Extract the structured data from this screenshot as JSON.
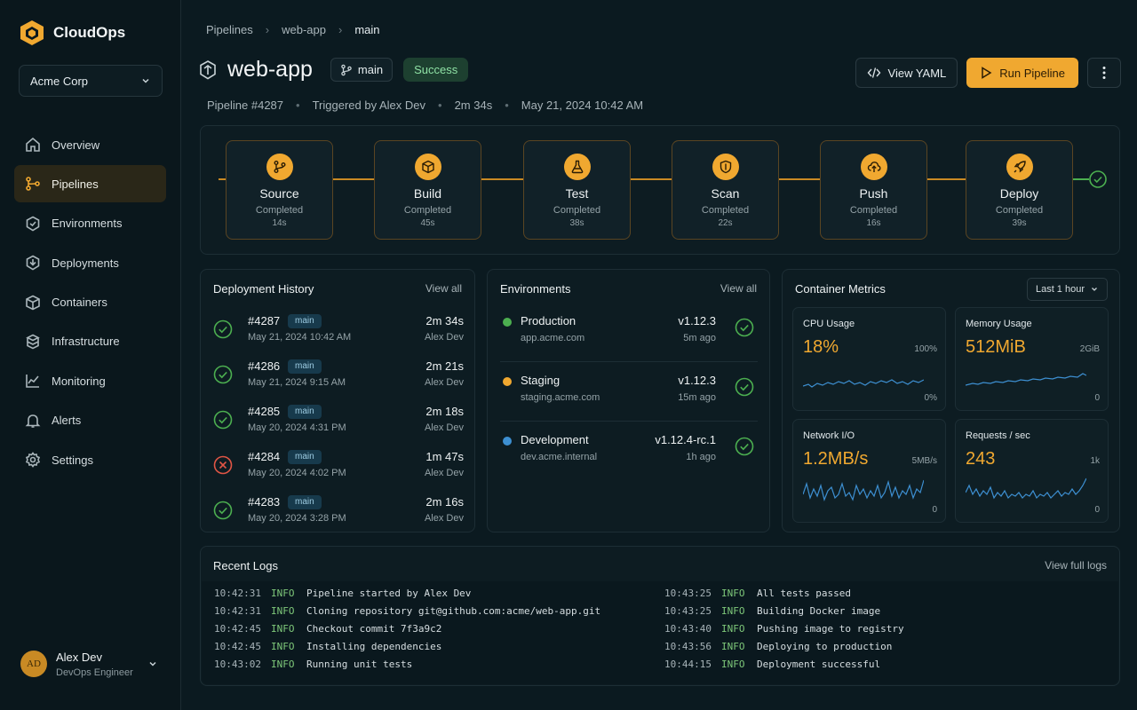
{
  "app": {
    "name": "CloudOps"
  },
  "org": {
    "name": "Acme Corp"
  },
  "sidebar": {
    "items": [
      {
        "label": "Overview",
        "icon": "home-icon"
      },
      {
        "label": "Pipelines",
        "icon": "pipeline-icon",
        "active": true
      },
      {
        "label": "Environments",
        "icon": "environment-icon"
      },
      {
        "label": "Deployments",
        "icon": "deployment-icon"
      },
      {
        "label": "Containers",
        "icon": "container-icon"
      },
      {
        "label": "Infrastructure",
        "icon": "infrastructure-icon"
      },
      {
        "label": "Monitoring",
        "icon": "monitoring-icon"
      },
      {
        "label": "Alerts",
        "icon": "bell-icon"
      },
      {
        "label": "Settings",
        "icon": "gear-icon"
      }
    ]
  },
  "user": {
    "initials": "AD",
    "name": "Alex Dev",
    "role": "DevOps Engineer"
  },
  "breadcrumb": [
    "Pipelines",
    "web-app",
    "main"
  ],
  "header": {
    "title": "web-app",
    "branch": "main",
    "status": "Success",
    "meta": [
      "Pipeline #4287",
      "Triggered by Alex Dev",
      "2m 34s",
      "May 21, 2024 10:42 AM"
    ],
    "view_yaml": "View YAML",
    "run_pipeline": "Run Pipeline"
  },
  "stages": [
    {
      "name": "Source",
      "status": "Completed",
      "time": "14s",
      "icon": "git-branch-icon"
    },
    {
      "name": "Build",
      "status": "Completed",
      "time": "45s",
      "icon": "box-icon"
    },
    {
      "name": "Test",
      "status": "Completed",
      "time": "38s",
      "icon": "flask-icon"
    },
    {
      "name": "Scan",
      "status": "Completed",
      "time": "22s",
      "icon": "shield-icon"
    },
    {
      "name": "Push",
      "status": "Completed",
      "time": "16s",
      "icon": "cloud-upload-icon"
    },
    {
      "name": "Deploy",
      "status": "Completed",
      "time": "39s",
      "icon": "rocket-icon"
    }
  ],
  "history": {
    "title": "Deployment History",
    "view_all": "View all",
    "rows": [
      {
        "id": "#4287",
        "branch": "main",
        "date": "May 21, 2024 10:42 AM",
        "duration": "2m 34s",
        "by": "Alex Dev",
        "ok": true
      },
      {
        "id": "#4286",
        "branch": "main",
        "date": "May 21, 2024 9:15 AM",
        "duration": "2m 21s",
        "by": "Alex Dev",
        "ok": true
      },
      {
        "id": "#4285",
        "branch": "main",
        "date": "May 20, 2024 4:31 PM",
        "duration": "2m 18s",
        "by": "Alex Dev",
        "ok": true
      },
      {
        "id": "#4284",
        "branch": "main",
        "date": "May 20, 2024 4:02 PM",
        "duration": "1m 47s",
        "by": "Alex Dev",
        "ok": false
      },
      {
        "id": "#4283",
        "branch": "main",
        "date": "May 20, 2024 3:28 PM",
        "duration": "2m 16s",
        "by": "Alex Dev",
        "ok": true
      }
    ]
  },
  "environments": {
    "title": "Environments",
    "view_all": "View all",
    "rows": [
      {
        "name": "Production",
        "host": "app.acme.com",
        "version": "v1.12.3",
        "ago": "5m ago",
        "color": "#4caf50"
      },
      {
        "name": "Staging",
        "host": "staging.acme.com",
        "version": "v1.12.3",
        "ago": "15m ago",
        "color": "#f0a830"
      },
      {
        "name": "Development",
        "host": "dev.acme.internal",
        "version": "v1.12.4-rc.1",
        "ago": "1h ago",
        "color": "#3d8fd1"
      }
    ]
  },
  "metrics": {
    "title": "Container Metrics",
    "range": "Last 1 hour",
    "items": [
      {
        "title": "CPU Usage",
        "value": "18%",
        "max": "100%",
        "min": "0%"
      },
      {
        "title": "Memory Usage",
        "value": "512MiB",
        "max": "2GiB",
        "min": "0"
      },
      {
        "title": "Network I/O",
        "value": "1.2MB/s",
        "max": "5MB/s",
        "min": "0"
      },
      {
        "title": "Requests / sec",
        "value": "243",
        "max": "1k",
        "min": "0"
      }
    ]
  },
  "logs": {
    "title": "Recent Logs",
    "view_full": "View full logs",
    "left": [
      {
        "time": "10:42:31",
        "level": "INFO",
        "msg": "Pipeline started by Alex Dev"
      },
      {
        "time": "10:42:31",
        "level": "INFO",
        "msg": "Cloning repository git@github.com:acme/web-app.git"
      },
      {
        "time": "10:42:45",
        "level": "INFO",
        "msg": "Checkout commit 7f3a9c2"
      },
      {
        "time": "10:42:45",
        "level": "INFO",
        "msg": "Installing dependencies"
      },
      {
        "time": "10:43:02",
        "level": "INFO",
        "msg": "Running unit tests"
      }
    ],
    "right": [
      {
        "time": "10:43:25",
        "level": "INFO",
        "msg": "All tests passed"
      },
      {
        "time": "10:43:25",
        "level": "INFO",
        "msg": "Building Docker image"
      },
      {
        "time": "10:43:40",
        "level": "INFO",
        "msg": "Pushing image to registry"
      },
      {
        "time": "10:43:56",
        "level": "INFO",
        "msg": "Deploying to production"
      },
      {
        "time": "10:44:15",
        "level": "INFO",
        "msg": "Deployment successful"
      }
    ]
  },
  "colors": {
    "accent": "#f0a830",
    "success": "#4caf50",
    "error": "#e05545",
    "background": "#0b1a20"
  }
}
